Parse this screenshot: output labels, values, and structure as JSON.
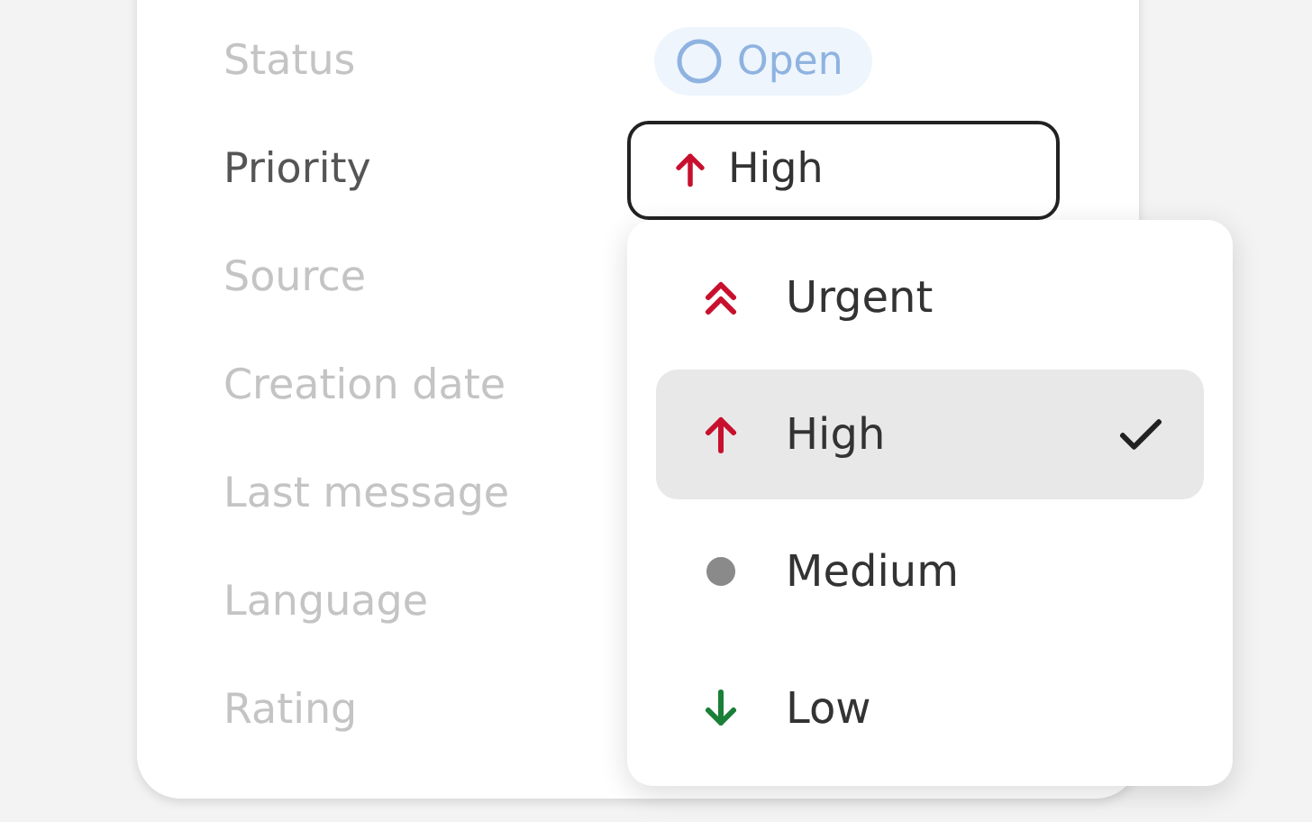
{
  "fields": [
    {
      "label": "Status",
      "dimmed": true,
      "value": {
        "kind": "status",
        "text": "Open"
      }
    },
    {
      "label": "Priority",
      "dimmed": false,
      "value": {
        "kind": "select",
        "text": "High"
      }
    },
    {
      "label": "Source",
      "dimmed": true
    },
    {
      "label": "Creation date",
      "dimmed": true
    },
    {
      "label": "Last message",
      "dimmed": true
    },
    {
      "label": "Language",
      "dimmed": true
    },
    {
      "label": "Rating",
      "dimmed": true
    }
  ],
  "dropdown": {
    "options": [
      {
        "label": "Urgent",
        "kind": "urgent",
        "selected": false
      },
      {
        "label": "High",
        "kind": "high",
        "selected": true
      },
      {
        "label": "Medium",
        "kind": "medium",
        "selected": false
      },
      {
        "label": "Low",
        "kind": "low",
        "selected": false
      }
    ]
  }
}
